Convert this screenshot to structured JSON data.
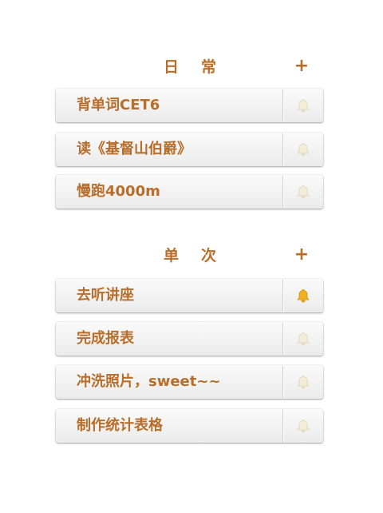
{
  "colors": {
    "accent": "#b86e2a",
    "bell_off": "#f3ecd6",
    "bell_on": "#f2b01e"
  },
  "sections": [
    {
      "title": "日常",
      "add_label": "+",
      "tasks": [
        {
          "label": "背单词CET6",
          "bell": "bell-off-icon"
        },
        {
          "label": "读《基督山伯爵》",
          "bell": "bell-off-icon"
        },
        {
          "label": "慢跑4000m",
          "bell": "bell-off-icon"
        }
      ]
    },
    {
      "title": "单次",
      "add_label": "+",
      "tasks": [
        {
          "label": "去听讲座",
          "bell": "bell-on-icon"
        },
        {
          "label": "完成报表",
          "bell": "bell-off-icon"
        },
        {
          "label": "冲洗照片，sweet~~",
          "bell": "bell-off-icon"
        },
        {
          "label": "制作统计表格",
          "bell": "bell-off-icon"
        }
      ]
    }
  ]
}
